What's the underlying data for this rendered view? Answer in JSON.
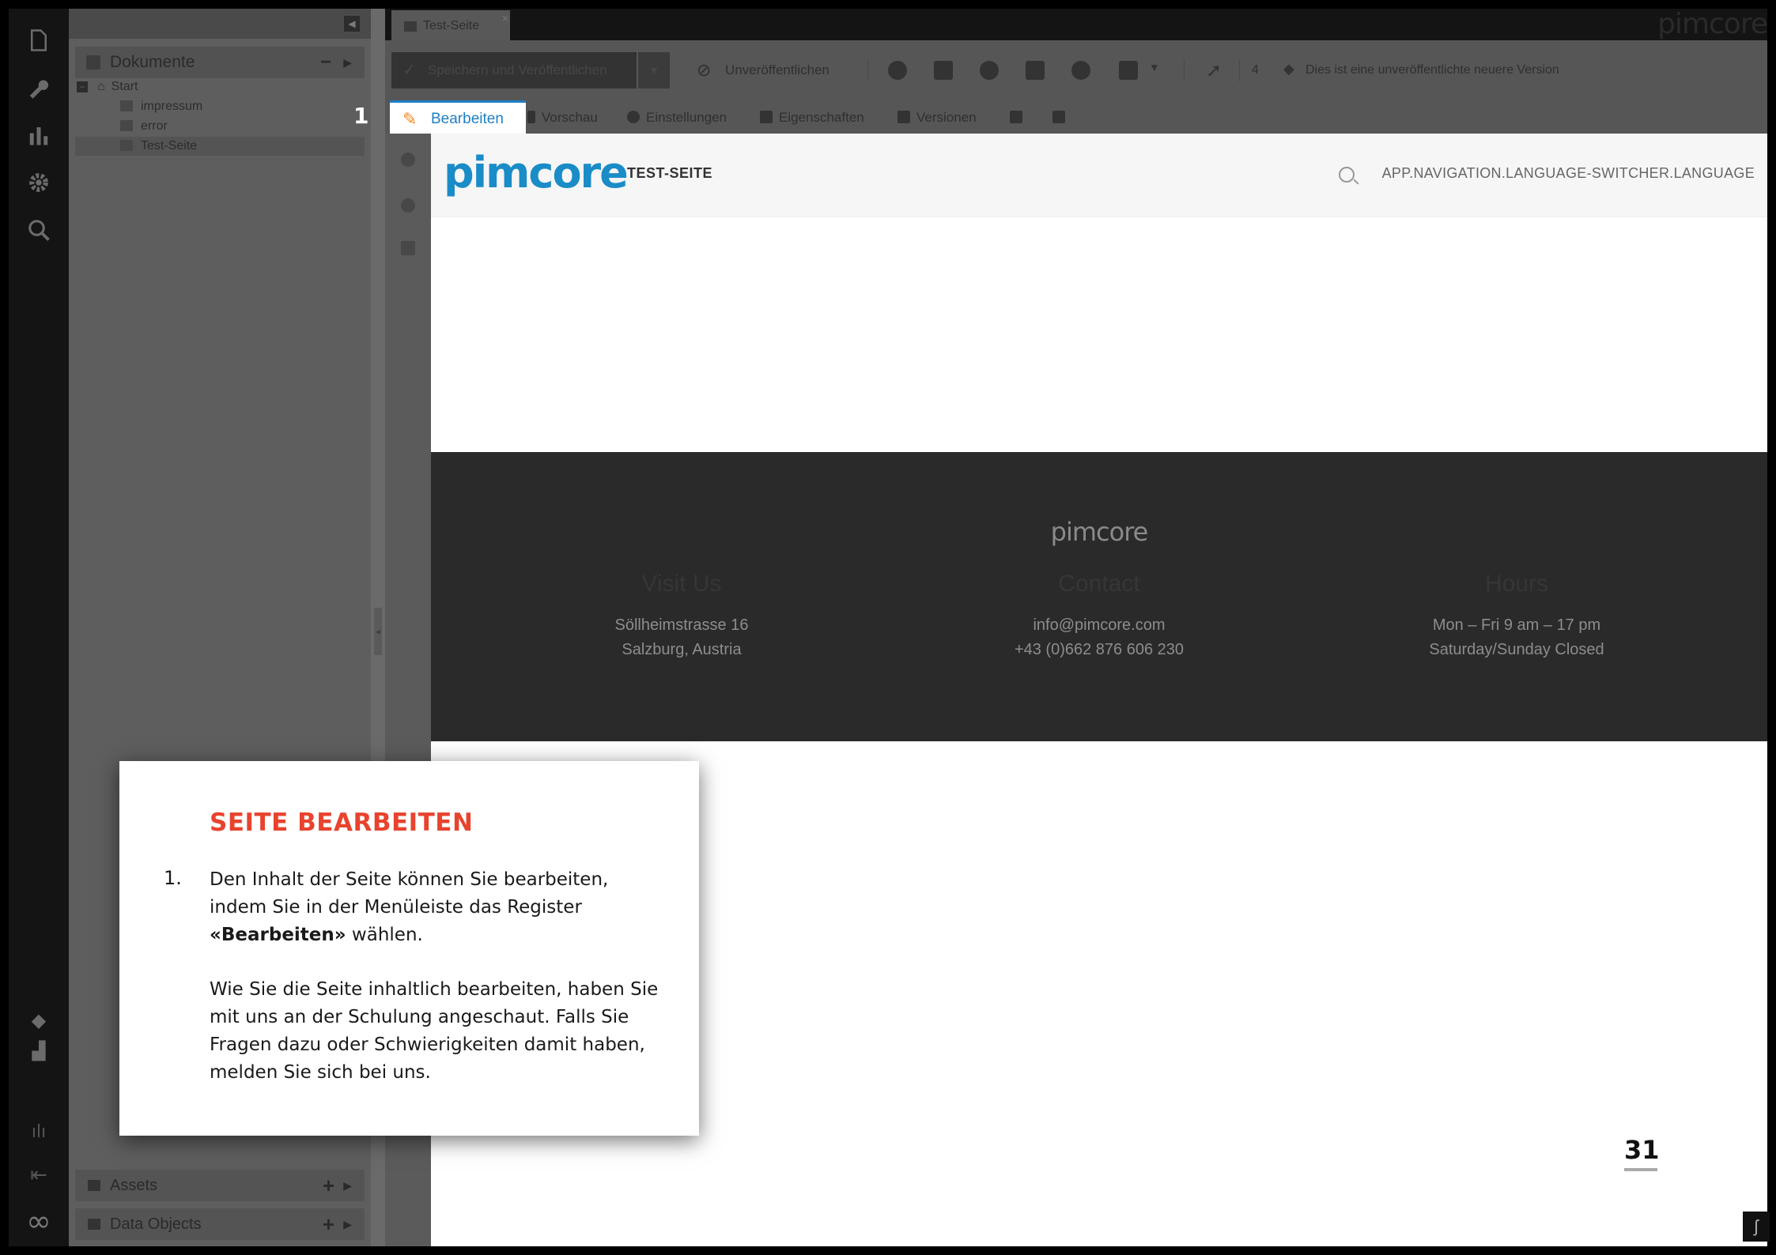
{
  "doc_tab": {
    "label": "Test-Seite",
    "close": "×"
  },
  "brand_top": "pimcore",
  "tree": {
    "header": "Dokumente",
    "nodes": [
      "Start",
      "impressum",
      "error",
      "Test-Seite"
    ],
    "bottom_panels": [
      "Assets",
      "Data Objects"
    ]
  },
  "toolbar": {
    "save_label": "Speichern und Veröffentlichen",
    "unpublish_label": "Unveröffentlichen",
    "version_count": "4",
    "version_note": "Dies ist eine unveröffentlichte neuere Version"
  },
  "subtabs": {
    "edit": "Bearbeiten",
    "preview": "Vorschau",
    "settings": "Einstellungen",
    "properties": "Eigenschaften",
    "versions": "Versionen"
  },
  "step_marker": "1",
  "preview": {
    "logo": "pimcore",
    "nav_title": "TEST-SEITE",
    "lang_switch": "APP.NAVIGATION.LANGUAGE-SWITCHER.LANGUAGE",
    "footer": {
      "logo": "pimcore",
      "columns": [
        {
          "heading": "Visit Us",
          "line1": "Söllheimstrasse 16",
          "line2": "Salzburg, Austria"
        },
        {
          "heading": "Contact",
          "line1": "info@pimcore.com",
          "line2": "+43 (0)662 876 606 230"
        },
        {
          "heading": "Hours",
          "line1": "Mon – Fri 9 am – 17 pm",
          "line2": "Saturday/Sunday Closed"
        }
      ]
    }
  },
  "callout": {
    "title": "SEITE BEARBEITEN",
    "number": "1.",
    "p1_before": "Den Inhalt der Seite können Sie bearbeiten, indem Sie in der Menüleiste das Register ",
    "p1_bold": "«Bearbeiten»",
    "p1_after": " wählen.",
    "p2": "Wie Sie die Seite inhaltlich bearbeiten, haben Sie mit uns an der Schulung angeschaut. Falls Sie Fragen dazu oder Schwierigkeiten damit haben, melden Sie sich bei uns."
  },
  "page_number": "31",
  "corner_badge": "ʃ"
}
